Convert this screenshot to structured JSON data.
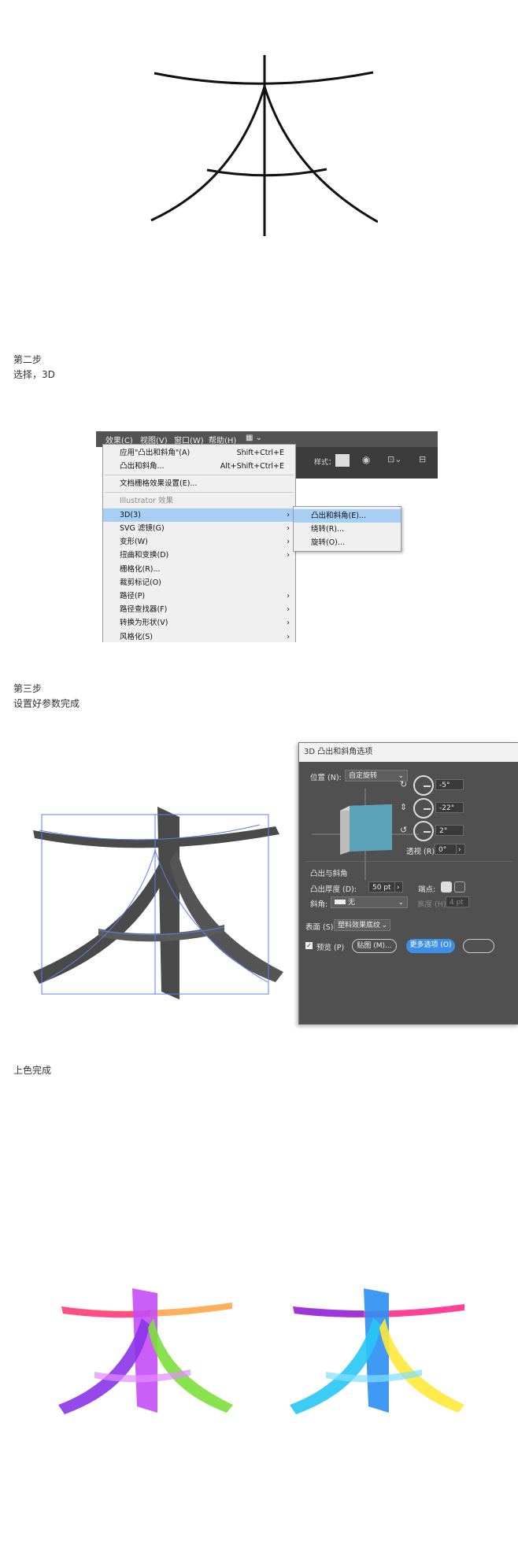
{
  "steps": {
    "step2_title": "第二步",
    "step2_desc": "选择，3D",
    "step3_title": "第三步",
    "step3_desc": "设置好参数完成",
    "step4_title": "上色完成"
  },
  "menu": {
    "bar": [
      "效果(C)",
      "视图(V)",
      "窗口(W)",
      "帮助(H)"
    ],
    "control_style_label": "样式：",
    "items": [
      {
        "label": "应用\"凸出和斜角\"(A)",
        "shortcut": "Shift+Ctrl+E"
      },
      {
        "label": "凸出和斜角...",
        "shortcut": "Alt+Shift+Ctrl+E"
      },
      {
        "label": "文档栅格效果设置(E)..."
      },
      {
        "label": "Illustrator 效果"
      },
      {
        "label": "3D(3)"
      },
      {
        "label": "SVG 滤镜(G)"
      },
      {
        "label": "变形(W)"
      },
      {
        "label": "扭曲和变换(D)"
      },
      {
        "label": "栅格化(R)..."
      },
      {
        "label": "裁剪标记(O)"
      },
      {
        "label": "路径(P)"
      },
      {
        "label": "路径查找器(F)"
      },
      {
        "label": "转换为形状(V)"
      },
      {
        "label": "风格化(S)"
      }
    ],
    "submenu": [
      "凸出和斜角(E)...",
      "绕转(R)...",
      "旋转(O)..."
    ]
  },
  "dialog": {
    "title": "3D 凸出和斜角选项",
    "position_label": "位置 (N):",
    "position_value": "自定旋转",
    "rot_x": "-5°",
    "rot_y": "-22°",
    "rot_z": "2°",
    "perspective_label": "透视 (R):",
    "perspective_value": "0°",
    "section_title": "凸出与斜角",
    "depth_label": "凸出厚度 (D):",
    "depth_value": "50 pt",
    "cap_label": "端点:",
    "bevel_label": "斜角:",
    "bevel_value": "无",
    "height_label": "高度 (H):",
    "height_value": "4 pt",
    "surface_label": "表面 (S):",
    "surface_value": "塑料效果底纹",
    "preview_label": "预览 (P)",
    "map_button": "贴图 (M)...",
    "more_button": "更多选项 (O)"
  },
  "colors": {
    "dialog_bg": "#505050",
    "cube_face": "#5ba3b8",
    "accent_blue": "#3d8fe6",
    "selection_blue": "#5b7fe8"
  }
}
